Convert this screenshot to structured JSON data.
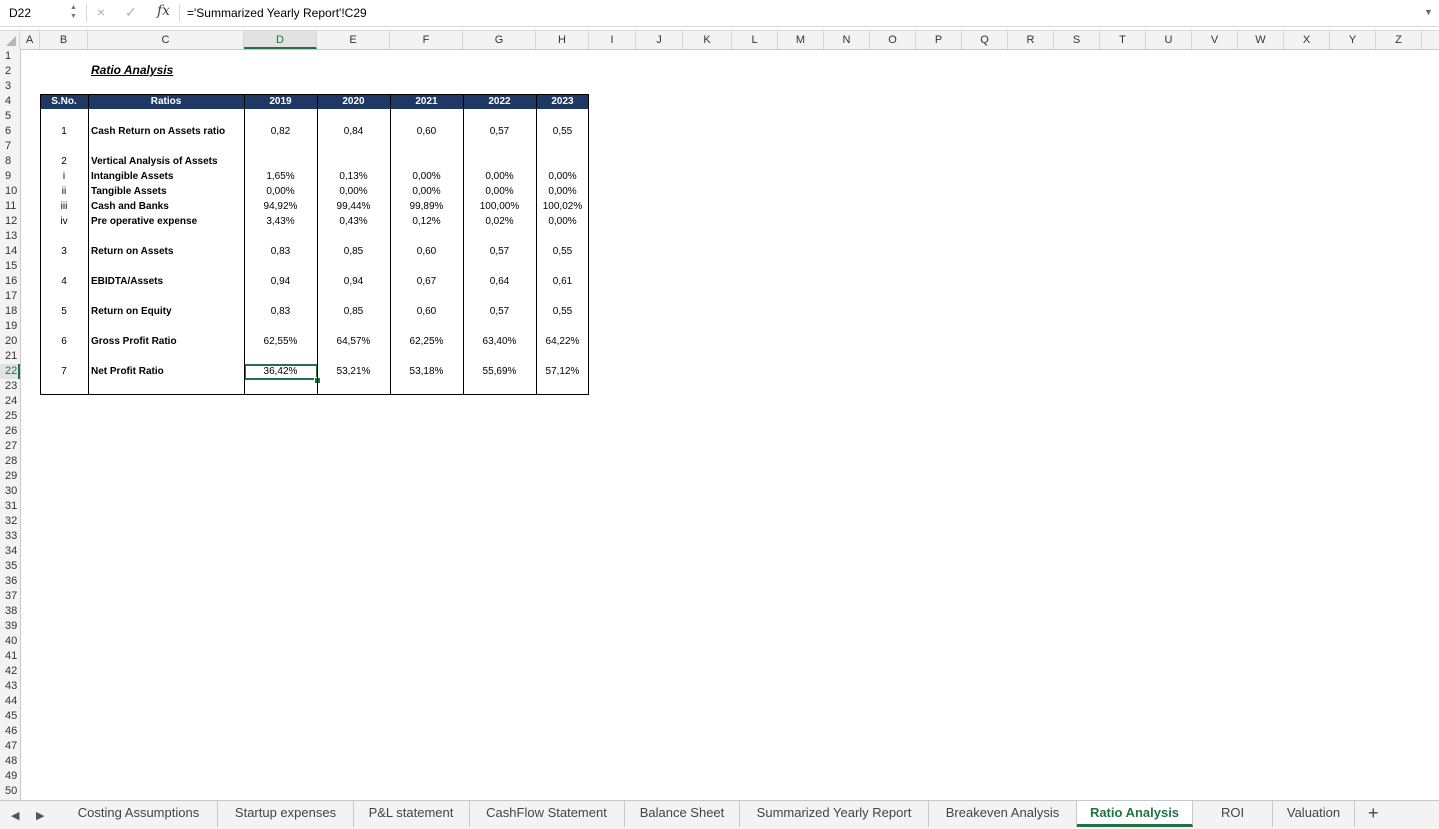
{
  "formula_bar": {
    "name_box": "D22",
    "formula": "='Summarized Yearly Report'!C29",
    "cancel_icon": "×",
    "confirm_icon": "✓",
    "fx_label": "fx"
  },
  "columns": [
    "A",
    "B",
    "C",
    "D",
    "E",
    "F",
    "G",
    "H",
    "I",
    "J",
    "K",
    "L",
    "M",
    "N",
    "O",
    "P",
    "Q",
    "R",
    "S",
    "T",
    "U",
    "V",
    "W",
    "X",
    "Y",
    "Z"
  ],
  "selected_column": "D",
  "rows": [
    "1",
    "2",
    "3",
    "4",
    "5",
    "6",
    "7",
    "8",
    "9",
    "10",
    "11",
    "12",
    "13",
    "14",
    "15",
    "16",
    "17",
    "18",
    "19",
    "20",
    "21",
    "22",
    "23",
    "24",
    "25",
    "26",
    "27",
    "28",
    "29",
    "30",
    "31",
    "32",
    "33",
    "34",
    "35",
    "36",
    "37",
    "38",
    "39",
    "40",
    "41",
    "42",
    "43",
    "44",
    "45",
    "46",
    "47",
    "48",
    "49",
    "50"
  ],
  "selected_row": "22",
  "sheet": {
    "title": "Ratio Analysis",
    "table": {
      "headers": [
        "S.No.",
        "Ratios",
        "2019",
        "2020",
        "2021",
        "2022",
        "2023"
      ],
      "rows": [
        {
          "sno": "1",
          "label": "Cash Return on Assets ratio",
          "values": [
            "0,82",
            "0,84",
            "0,60",
            "0,57",
            "0,55"
          ]
        },
        {
          "sno": "2",
          "label": "Vertical Analysis of Assets",
          "values": [
            "",
            "",
            "",
            "",
            ""
          ]
        },
        {
          "sno": "i",
          "label": "Intangible Assets",
          "values": [
            "1,65%",
            "0,13%",
            "0,00%",
            "0,00%",
            "0,00%"
          ]
        },
        {
          "sno": "ii",
          "label": "Tangible Assets",
          "values": [
            "0,00%",
            "0,00%",
            "0,00%",
            "0,00%",
            "0,00%"
          ]
        },
        {
          "sno": "iii",
          "label": "Cash and Banks",
          "values": [
            "94,92%",
            "99,44%",
            "99,89%",
            "100,00%",
            "100,02%"
          ]
        },
        {
          "sno": "iv",
          "label": "Pre operative expense",
          "values": [
            "3,43%",
            "0,43%",
            "0,12%",
            "0,02%",
            "0,00%"
          ]
        },
        {
          "sno": "3",
          "label": "Return on Assets",
          "values": [
            "0,83",
            "0,85",
            "0,60",
            "0,57",
            "0,55"
          ]
        },
        {
          "sno": "4",
          "label": "EBIDTA/Assets",
          "values": [
            "0,94",
            "0,94",
            "0,67",
            "0,64",
            "0,61"
          ]
        },
        {
          "sno": "5",
          "label": "Return on Equity",
          "values": [
            "0,83",
            "0,85",
            "0,60",
            "0,57",
            "0,55"
          ]
        },
        {
          "sno": "6",
          "label": "Gross Profit Ratio",
          "values": [
            "62,55%",
            "64,57%",
            "62,25%",
            "63,40%",
            "64,22%"
          ]
        },
        {
          "sno": "7",
          "label": "Net Profit Ratio",
          "values": [
            "36,42%",
            "53,21%",
            "53,18%",
            "55,69%",
            "57,12%"
          ]
        }
      ]
    }
  },
  "tabs": [
    "Costing Assumptions",
    "Startup expenses",
    "P&L statement",
    "CashFlow Statement",
    "Balance Sheet",
    "Summarized Yearly Report",
    "Breakeven Analysis",
    "Ratio Analysis",
    "ROI",
    "Valuation"
  ],
  "active_tab": "Ratio Analysis",
  "add_sheet_label": "+",
  "colors": {
    "header_fill": "#1f3864",
    "accent": "#217346"
  }
}
